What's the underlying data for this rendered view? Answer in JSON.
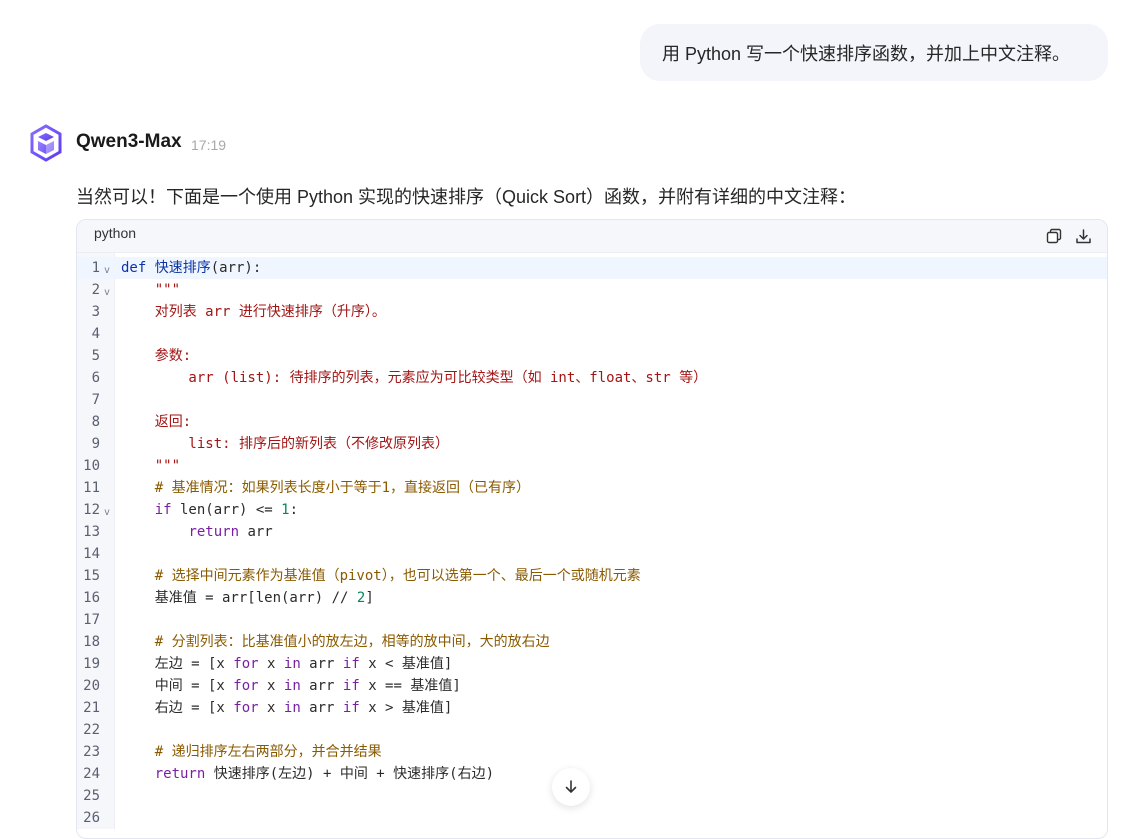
{
  "user_message": "用 Python 写一个快速排序函数，并加上中文注释。",
  "assistant": {
    "name": "Qwen3-Max",
    "time": "17:19",
    "intro": "当然可以！下面是一个使用 Python 实现的快速排序（Quick Sort）函数，并附有详细的中文注释："
  },
  "code_block": {
    "language": "python",
    "active_line": 1,
    "lines": [
      {
        "n": "1",
        "fold": true,
        "tokens": [
          [
            "kw2",
            "def "
          ],
          [
            "fn",
            "快速排序"
          ],
          [
            "op",
            "(arr):"
          ]
        ]
      },
      {
        "n": "2",
        "fold": true,
        "tokens": [
          [
            "str",
            "    \"\"\""
          ]
        ]
      },
      {
        "n": "3",
        "fold": false,
        "tokens": [
          [
            "str",
            "    对列表 arr 进行快速排序（升序）。"
          ]
        ]
      },
      {
        "n": "4",
        "fold": false,
        "tokens": []
      },
      {
        "n": "5",
        "fold": false,
        "tokens": [
          [
            "str",
            "    参数:"
          ]
        ]
      },
      {
        "n": "6",
        "fold": false,
        "tokens": [
          [
            "str",
            "        arr (list): 待排序的列表，元素应为可比较类型（如 int、float、str 等）"
          ]
        ]
      },
      {
        "n": "7",
        "fold": false,
        "tokens": []
      },
      {
        "n": "8",
        "fold": false,
        "tokens": [
          [
            "str",
            "    返回:"
          ]
        ]
      },
      {
        "n": "9",
        "fold": false,
        "tokens": [
          [
            "str",
            "        list: 排序后的新列表（不修改原列表）"
          ]
        ]
      },
      {
        "n": "10",
        "fold": false,
        "tokens": [
          [
            "str",
            "    \"\"\""
          ]
        ]
      },
      {
        "n": "11",
        "fold": false,
        "tokens": [
          [
            "cm",
            "    # 基准情况：如果列表长度小于等于1，直接返回（已有序）"
          ]
        ]
      },
      {
        "n": "12",
        "fold": true,
        "tokens": [
          [
            "op",
            "    "
          ],
          [
            "kw",
            "if"
          ],
          [
            "op",
            " len(arr) <= "
          ],
          [
            "num",
            "1"
          ],
          [
            "op",
            ":"
          ]
        ]
      },
      {
        "n": "13",
        "fold": false,
        "tokens": [
          [
            "op",
            "        "
          ],
          [
            "kw",
            "return"
          ],
          [
            "op",
            " arr"
          ]
        ]
      },
      {
        "n": "14",
        "fold": false,
        "tokens": []
      },
      {
        "n": "15",
        "fold": false,
        "tokens": [
          [
            "cm",
            "    # 选择中间元素作为基准值（pivot），也可以选第一个、最后一个或随机元素"
          ]
        ]
      },
      {
        "n": "16",
        "fold": false,
        "tokens": [
          [
            "op",
            "    基准值 = arr[len(arr) // "
          ],
          [
            "num",
            "2"
          ],
          [
            "op",
            "]"
          ]
        ]
      },
      {
        "n": "17",
        "fold": false,
        "tokens": []
      },
      {
        "n": "18",
        "fold": false,
        "tokens": [
          [
            "cm",
            "    # 分割列表：比基准值小的放左边，相等的放中间，大的放右边"
          ]
        ]
      },
      {
        "n": "19",
        "fold": false,
        "tokens": [
          [
            "op",
            "    左边 = [x "
          ],
          [
            "kw",
            "for"
          ],
          [
            "op",
            " x "
          ],
          [
            "kw",
            "in"
          ],
          [
            "op",
            " arr "
          ],
          [
            "kw",
            "if"
          ],
          [
            "op",
            " x < 基准值]"
          ]
        ]
      },
      {
        "n": "20",
        "fold": false,
        "tokens": [
          [
            "op",
            "    中间 = [x "
          ],
          [
            "kw",
            "for"
          ],
          [
            "op",
            " x "
          ],
          [
            "kw",
            "in"
          ],
          [
            "op",
            " arr "
          ],
          [
            "kw",
            "if"
          ],
          [
            "op",
            " x == 基准值]"
          ]
        ]
      },
      {
        "n": "21",
        "fold": false,
        "tokens": [
          [
            "op",
            "    右边 = [x "
          ],
          [
            "kw",
            "for"
          ],
          [
            "op",
            " x "
          ],
          [
            "kw",
            "in"
          ],
          [
            "op",
            " arr "
          ],
          [
            "kw",
            "if"
          ],
          [
            "op",
            " x > 基准值]"
          ]
        ]
      },
      {
        "n": "22",
        "fold": false,
        "tokens": []
      },
      {
        "n": "23",
        "fold": false,
        "tokens": [
          [
            "cm",
            "    # 递归排序左右两部分，并合并结果"
          ]
        ]
      },
      {
        "n": "24",
        "fold": false,
        "tokens": [
          [
            "op",
            "    "
          ],
          [
            "kw",
            "return"
          ],
          [
            "op",
            " 快速排序(左边) + 中间 + 快速排序(右边)"
          ]
        ]
      },
      {
        "n": "25",
        "fold": false,
        "tokens": []
      },
      {
        "n": "26",
        "fold": false,
        "tokens": []
      }
    ]
  },
  "icons": {
    "copy": "copy-icon",
    "download": "download-icon",
    "scroll_down": "arrow-down-icon",
    "avatar": "qwen-logo-icon"
  },
  "colors": {
    "logo": "#6a4cff",
    "keyword": "#7a1fa2",
    "string": "#a31515",
    "comment": "#8a5a00",
    "number": "#09865a"
  }
}
